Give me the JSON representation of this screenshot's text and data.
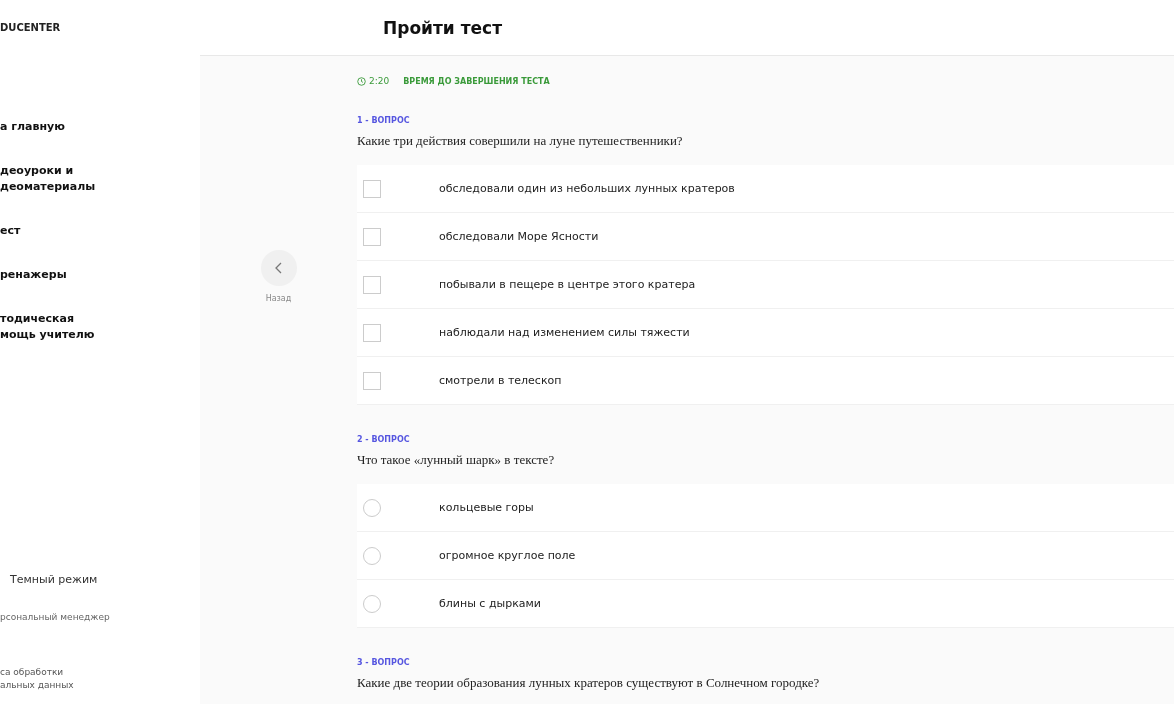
{
  "sidebar": {
    "logo": "DUCENTER",
    "items": [
      {
        "lines": [
          "а главную"
        ]
      },
      {
        "lines": [
          "деоуроки и",
          "деоматериалы"
        ]
      },
      {
        "lines": [
          "ест"
        ]
      },
      {
        "lines": [
          "ренажеры"
        ]
      },
      {
        "lines": [
          "тодическая",
          "мощь учителю"
        ]
      }
    ],
    "dark_mode": "Темный режим",
    "manager": "рсональный менеджер",
    "policy": [
      "са обработки",
      "альных данных"
    ]
  },
  "header": {
    "title": "Пройти тест"
  },
  "back": {
    "label": "Назад"
  },
  "timer": {
    "time": "2:20",
    "label": "ВРЕМЯ ДО ЗАВЕРШЕНИЯ ТЕСТА"
  },
  "questions": [
    {
      "number": "1 - ВОПРОС",
      "text": "Какие три действия совершили на луне путешественники?",
      "kind": "checkbox",
      "options": [
        {
          "text": "обследовали один из небольших лунных кратеров",
          "selected": false
        },
        {
          "text": "обследовали Море Ясности",
          "selected": false
        },
        {
          "text": "побывали в пещере в центре этого кратера",
          "selected": false
        },
        {
          "text": "наблюдали над изменением силы тяжести",
          "selected": false
        },
        {
          "text": "смотрели в телескоп",
          "selected": false
        }
      ]
    },
    {
      "number": "2 - ВОПРОС",
      "text": "Что такое «лунный шарк» в тексте?",
      "kind": "radio",
      "options": [
        {
          "text": "кольцевые горы",
          "selected": false
        },
        {
          "text": "огромное круглое поле",
          "selected": false
        },
        {
          "text": "блины с дырками",
          "selected": false
        }
      ]
    },
    {
      "number": "3 - ВОПРОС",
      "text": "Какие две теории образования лунных кратеров существуют в Солнечном городке?"
    }
  ]
}
